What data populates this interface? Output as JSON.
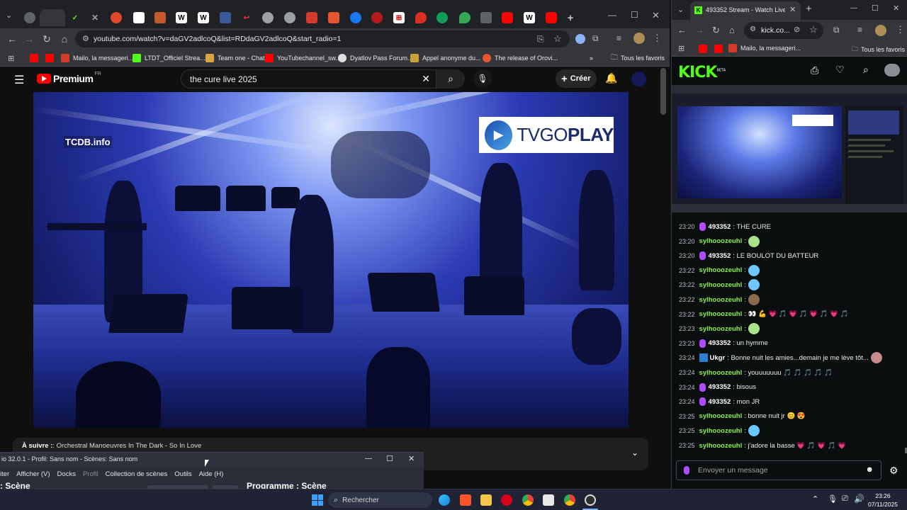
{
  "left_browser": {
    "url": "youtube.com/watch?v=daGV2adlcoQ&list=RDdaGV2adlcoQ&start_radio=1",
    "bookmarks": [
      "Mailo, la messageri...",
      "LTDT_Officiel Strea...",
      "Team one - Chat",
      "YouTubechannel_sw...",
      "Dyatlov Pass Forum...",
      "Appel anonyme du...",
      "The release of Orovi..."
    ],
    "bookmarks_more": "»",
    "bookmarks_folder": "Tous les favoris",
    "tab_icons": [
      {
        "glyph": "W",
        "color": "#ffffff"
      },
      {
        "glyph": "W",
        "color": "#ffffff"
      },
      {
        "glyph": "W",
        "color": "#ffffff"
      },
      {
        "glyph": "W",
        "color": "#ffffff"
      }
    ]
  },
  "youtube": {
    "logo_text": "Premium",
    "logo_region": "FR",
    "search_value": "the cure live 2025",
    "create_label": "Créer",
    "up_next_prefix": "À suivre :",
    "up_next_title": ": Orchestral Manoeuvres In The Dark - So In Love",
    "overlay_tcdb": "TCDB.info",
    "overlay_tvgo_a": "TVGO",
    "overlay_tvgo_b": "PLAY"
  },
  "obs": {
    "title": "io 32.0.1 - Profil: Sans nom - Scènes: Sans nom",
    "menu": [
      "iter",
      "Afficher (V)",
      "Docks",
      "Profil",
      "Collection de scènes",
      "Outils",
      "Aide (H)"
    ],
    "panel_left": ": Scène",
    "panel_right": "Programme : Scène"
  },
  "right_browser": {
    "tab_title": "493352 Stream - Watch Live on",
    "url": "kick.co...",
    "bookmark": "Mailo, la messageri...",
    "bookmarks_folder": "Tous les favoris",
    "kick_logo": "KICK",
    "kick_badge": "BETA",
    "chat_placeholder": "Envoyer un message"
  },
  "chat": [
    {
      "time": "23:20",
      "user": "493352",
      "mic": true,
      "text": ": THE CURE",
      "emotes": []
    },
    {
      "time": "23:20",
      "user": "sylhooozeuhl",
      "mic": false,
      "text": ":",
      "emotes": [
        "#a8e38a"
      ]
    },
    {
      "time": "23:20",
      "user": "493352",
      "mic": true,
      "text": ": LE BOULOT DU BATTEUR",
      "emotes": []
    },
    {
      "time": "23:22",
      "user": "sylhooozeuhl",
      "mic": false,
      "text": ":",
      "emotes": [
        "#6cc8ff"
      ]
    },
    {
      "time": "23:22",
      "user": "sylhooozeuhl",
      "mic": false,
      "text": ":",
      "emotes": [
        "#6cc8ff"
      ]
    },
    {
      "time": "23:22",
      "user": "sylhooozeuhl",
      "mic": false,
      "text": ":",
      "emotes": [
        "#8a6a4a"
      ]
    },
    {
      "time": "23:22",
      "user": "sylhooozeuhl",
      "mic": false,
      "text": ": 👀 💪 💗 🎵 💗 🎵 💗 🎵 💗 🎵",
      "emotes": []
    },
    {
      "time": "23:23",
      "user": "sylhooozeuhl",
      "mic": false,
      "text": ":",
      "emotes": [
        "#a8e38a"
      ]
    },
    {
      "time": "23:23",
      "user": "493352",
      "mic": true,
      "text": ": un hymme",
      "emotes": []
    },
    {
      "time": "23:24",
      "user": "Ukgr",
      "mic": false,
      "text": ": Bonne nuit les amies...demain je me lève tôt...",
      "emotes": [
        "#c98a8a"
      ]
    },
    {
      "time": "23:24",
      "user": "sylhooozeuhl",
      "mic": false,
      "text": ": youuuuuuu 🎵 🎵 🎵 🎵 🎵",
      "emotes": []
    },
    {
      "time": "23:24",
      "user": "493352",
      "mic": true,
      "text": ": bisous",
      "emotes": []
    },
    {
      "time": "23:24",
      "user": "493352",
      "mic": true,
      "text": ": mon JR",
      "emotes": []
    },
    {
      "time": "23:25",
      "user": "sylhooozeuhl",
      "mic": false,
      "text": ": bonne nuit jr 😊 😍",
      "emotes": []
    },
    {
      "time": "23:25",
      "user": "sylhooozeuhl",
      "mic": false,
      "text": ":",
      "emotes": [
        "#6cc8ff"
      ]
    },
    {
      "time": "23:25",
      "user": "sylhooozeuhl",
      "mic": false,
      "text": ": j'adore la basse 💗 🎵 💗 🎵 💗",
      "emotes": []
    }
  ],
  "taskbar": {
    "search_label": "Rechercher",
    "time": "23:26",
    "date": "07/11/2025"
  },
  "colors": {
    "kick_green": "#53fc18",
    "youtube_red": "#ff0000",
    "chat_user_green": "#8df04a",
    "mic_purple": "#b04bff"
  }
}
